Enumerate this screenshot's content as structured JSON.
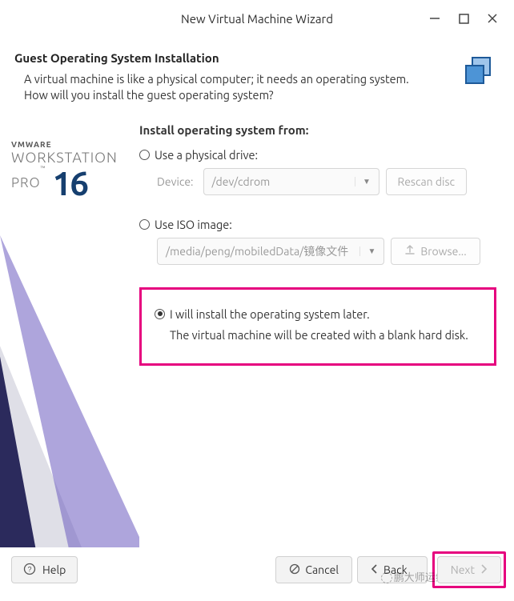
{
  "window": {
    "title": "New Virtual Machine Wizard"
  },
  "header": {
    "title": "Guest Operating System Installation",
    "description": "A virtual machine is like a physical computer; it needs an operating system. How will you install the guest operating system?"
  },
  "brand": {
    "vmware": "VMWARE",
    "workstation": "WORKSTATION",
    "pro": "PRO",
    "tm": "™",
    "version": "16"
  },
  "section_title": "Install operating system from:",
  "options": {
    "physical": {
      "label": "Use a physical drive:",
      "device_label": "Device:",
      "device_value": "/dev/cdrom",
      "rescan_label": "Rescan disc"
    },
    "iso": {
      "label": "Use ISO image:",
      "path_value": "/media/peng/mobiledData/镜像文件",
      "browse_label": "Browse..."
    },
    "later": {
      "label": "I will install the operating system later.",
      "sub": "The virtual machine will be created with a blank hard disk."
    }
  },
  "footer": {
    "help": "Help",
    "cancel": "Cancel",
    "back": "Back",
    "next": "Next"
  },
  "watermark": "鹏大师运维"
}
